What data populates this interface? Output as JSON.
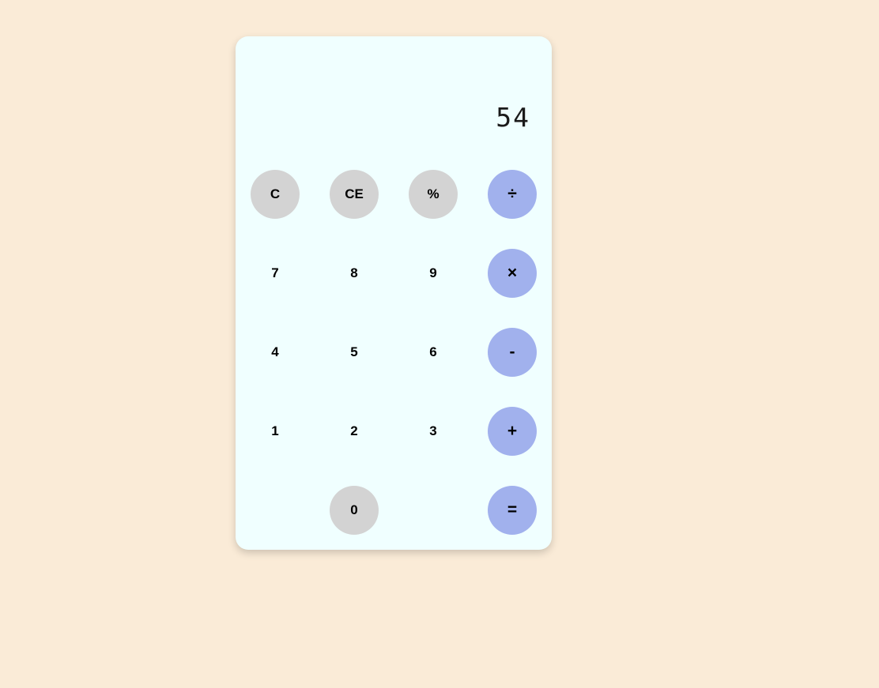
{
  "display": {
    "value": "54"
  },
  "colors": {
    "page_background": "#faebd7",
    "calculator_background": "#f0ffff",
    "function_key": "#d3d3d3",
    "operator_key": "#a1b1ed"
  },
  "keys": {
    "clear": "C",
    "clear_entry": "CE",
    "percent": "%",
    "divide": "÷",
    "seven": "7",
    "eight": "8",
    "nine": "9",
    "multiply": "×",
    "four": "4",
    "five": "5",
    "six": "6",
    "subtract": "-",
    "one": "1",
    "two": "2",
    "three": "3",
    "add": "+",
    "zero": "0",
    "equals": "="
  }
}
